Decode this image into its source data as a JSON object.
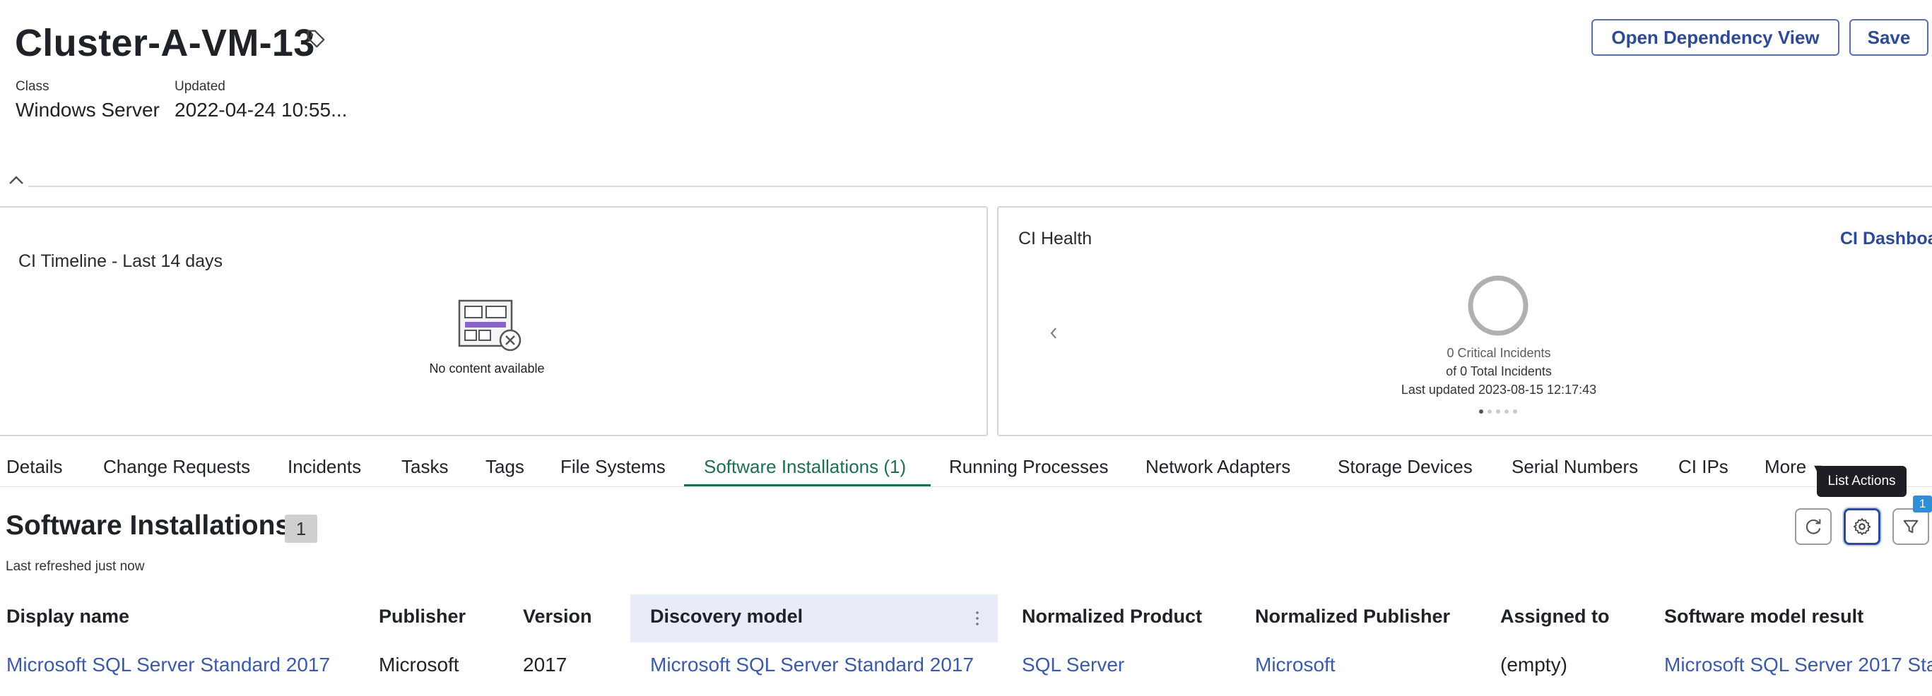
{
  "header": {
    "title": "Cluster-A-VM-13",
    "class_label": "Class",
    "class_value": "Windows Server",
    "updated_label": "Updated",
    "updated_value": "2022-04-24 10:55...",
    "open_dependency_label": "Open Dependency View",
    "save_label": "Save"
  },
  "timeline_card": {
    "title": "CI Timeline - Last 14 days",
    "empty_text": "No content available"
  },
  "health_card": {
    "title": "CI Health",
    "dashboard_link": "CI Dashboa",
    "critical_text": "0 Critical Incidents",
    "total_text": "of 0 Total Incidents",
    "last_updated_text": "Last updated 2023-08-15 12:17:43"
  },
  "tabs": [
    {
      "label": "Details"
    },
    {
      "label": "Change Requests"
    },
    {
      "label": "Incidents"
    },
    {
      "label": "Tasks"
    },
    {
      "label": "Tags"
    },
    {
      "label": "File Systems"
    },
    {
      "label": "Software Installations (1)"
    },
    {
      "label": "Running Processes"
    },
    {
      "label": "Network Adapters"
    },
    {
      "label": "Storage Devices"
    },
    {
      "label": "Serial Numbers"
    },
    {
      "label": "CI IPs"
    },
    {
      "label": "More"
    }
  ],
  "tooltip": "List Actions",
  "list": {
    "title": "Software Installations",
    "count": "1",
    "refreshed": "Last refreshed just now",
    "filter_count": "1",
    "columns": [
      "Display name",
      "Publisher",
      "Version",
      "Discovery model",
      "Normalized Product",
      "Normalized Publisher",
      "Assigned to",
      "Software model result"
    ],
    "rows": [
      [
        "Microsoft SQL Server Standard 2017",
        "Microsoft",
        "2017",
        "Microsoft SQL Server Standard 2017",
        "SQL Server",
        "Microsoft",
        "(empty)",
        "Microsoft SQL Server 2017 Star"
      ]
    ]
  },
  "colors": {
    "accent": "#2d4a96",
    "link": "#3b5aa8",
    "active_tab": "#1e6e52",
    "badge": "#2f8fd6"
  }
}
